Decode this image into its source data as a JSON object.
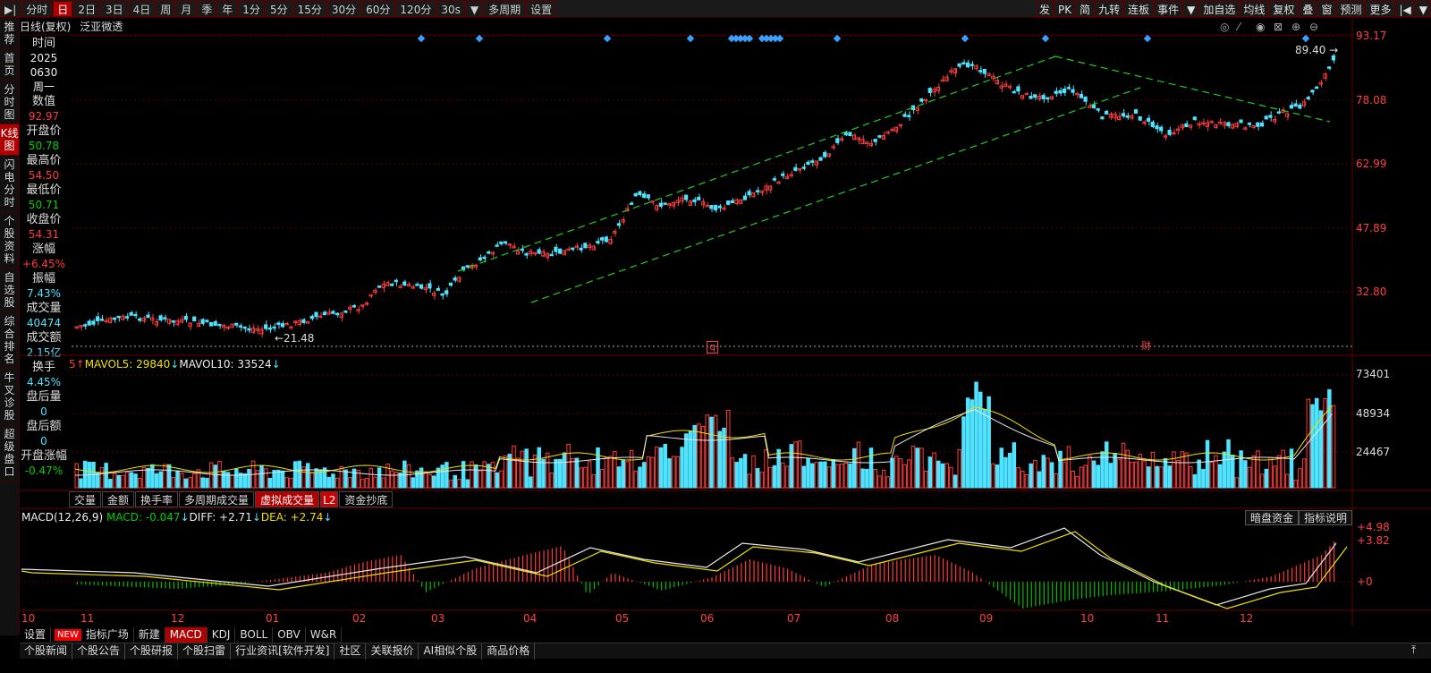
{
  "toolbar": {
    "left": [
      "分时",
      "日",
      "2日",
      "3日",
      "4日",
      "周",
      "月",
      "季",
      "年",
      "1分",
      "5分",
      "15分",
      "30分",
      "60分",
      "120分",
      "30s",
      "多周期",
      "设置"
    ],
    "active": "日",
    "right": [
      "发",
      "PK",
      "简",
      "九转",
      "连板",
      "事件",
      "加自选",
      "均线",
      "复权",
      "叠",
      "窗",
      "预测",
      "更多"
    ]
  },
  "leftnav": [
    "推荐",
    "首页",
    "分时图",
    "K线图",
    "闪电分时",
    "个股资料",
    "自选股",
    "综合排名",
    "牛叉诊股",
    "超级盘口"
  ],
  "leftnav_active": "K线图",
  "title": {
    "period": "日线(复权)",
    "name": "泛亚微透"
  },
  "info": [
    {
      "label": "时间",
      "value": "2025",
      "color": "wht"
    },
    {
      "label": "",
      "value": "0630",
      "color": "wht"
    },
    {
      "label": "",
      "value": "周一",
      "color": "wht"
    },
    {
      "label": "数值",
      "value": "92.97",
      "color": "red"
    },
    {
      "label": "开盘价",
      "value": "50.78",
      "color": "grn"
    },
    {
      "label": "最高价",
      "value": "54.50",
      "color": "red"
    },
    {
      "label": "最低价",
      "value": "50.71",
      "color": "grn"
    },
    {
      "label": "收盘价",
      "value": "54.31",
      "color": "red"
    },
    {
      "label": "涨幅",
      "value": "+6.45%",
      "color": "red"
    },
    {
      "label": "振幅",
      "value": "7.43%",
      "color": "cyn"
    },
    {
      "label": "成交量",
      "value": "40474",
      "color": "cyn"
    },
    {
      "label": "成交额",
      "value": "2.15亿",
      "color": "cyn"
    },
    {
      "label": "换手",
      "value": "4.45%",
      "color": "cyn"
    },
    {
      "label": "盘后量",
      "value": "0",
      "color": "cyn"
    },
    {
      "label": "盘后额",
      "value": "0",
      "color": "cyn"
    },
    {
      "label": "开盘涨幅",
      "value": "-0.47%",
      "color": "grn"
    }
  ],
  "price_axis": [
    "93.17",
    "78.08",
    "62.99",
    "47.89",
    "32.80"
  ],
  "price_notes": {
    "high": "89.40 →",
    "low": "←21.48",
    "event1": "q",
    "event2": "财"
  },
  "volume": {
    "legend_prefix": "5",
    "mavol5": "MAVOL5: 29840",
    "mavol10": "MAVOL10: 33524",
    "axis": [
      "73401",
      "48934",
      "24467"
    ],
    "tabs": [
      "交量",
      "金额",
      "换手率",
      "多周期成交量",
      "虚拟成交量",
      "资金抄底"
    ],
    "active": "虚拟成交量",
    "l2": "L2"
  },
  "macd": {
    "title": "MACD(12,26,9)",
    "macd": "MACD: -0.047",
    "diff": "DIFF: +2.71",
    "dea": "DEA: +2.74",
    "axis": [
      "+4.98",
      "+3.82",
      "+0"
    ],
    "btn1": "暗盘资金",
    "btn2": "指标说明"
  },
  "months": [
    "10",
    "11",
    "12",
    "01",
    "02",
    "03",
    "04",
    "05",
    "06",
    "07",
    "08",
    "09",
    "10",
    "11",
    "12"
  ],
  "bottom_tabs": [
    "设置",
    "指标广场",
    "新建",
    "MACD",
    "KDJ",
    "BOLL",
    "OBV",
    "W&R"
  ],
  "bottom_new": "NEW",
  "bottom_active": "MACD",
  "news": [
    "个股新闻",
    "个股公告",
    "个股研报",
    "个股扫雷",
    "行业资讯[软件开发]",
    "社区",
    "关联报价",
    "AI相似个股",
    "商品价格"
  ],
  "colors": {
    "up": "#ff3b3b",
    "down": "#4fe3ff",
    "ma_white": "#e8e8e8",
    "ma_yellow": "#f0e000",
    "trend": "#22cc22"
  }
}
